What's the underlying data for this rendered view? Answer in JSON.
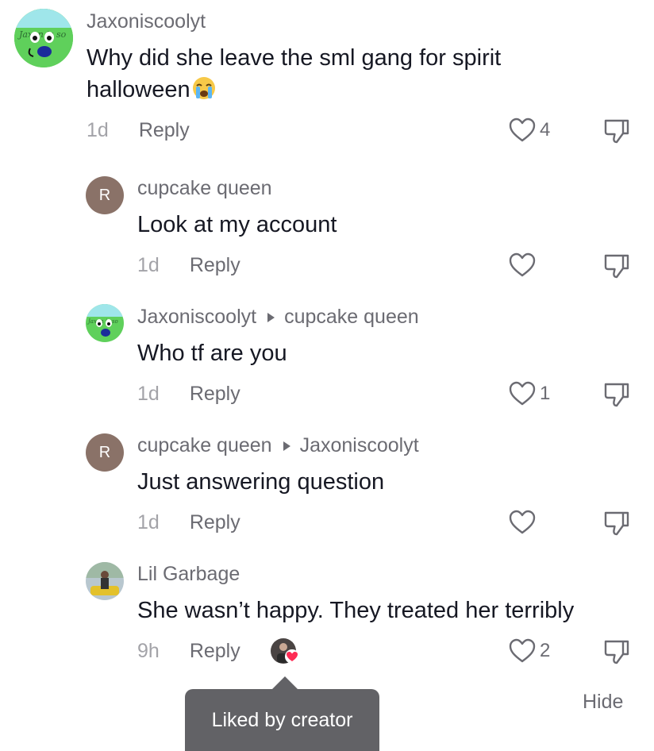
{
  "comments": [
    {
      "user": "Jaxoniscoolyt",
      "text": "Why did she leave the sml gang for spirit",
      "text2": "halloween",
      "time": "1d",
      "reply": "Reply",
      "likes": "4",
      "avatar_text": "Jaxon is so"
    },
    {
      "user": "cupcake queen",
      "avatar_letter": "R",
      "text": "Look at my account",
      "time": "1d",
      "reply": "Reply",
      "likes": ""
    },
    {
      "user": "Jaxoniscoolyt",
      "reply_to": "cupcake queen",
      "text": "Who tf are you",
      "time": "1d",
      "reply": "Reply",
      "likes": "1",
      "avatar_text": "Jaxon is so"
    },
    {
      "user": "cupcake queen",
      "avatar_letter": "R",
      "reply_to": "Jaxoniscoolyt",
      "text": "Just answering question",
      "time": "1d",
      "reply": "Reply",
      "likes": ""
    },
    {
      "user": "Lil Garbage",
      "text": "She wasn’t happy. They treated her terribly",
      "time": "9h",
      "reply": "Reply",
      "likes": "2"
    }
  ],
  "tooltip": {
    "text": "Liked by creator"
  },
  "hide_label": "Hide",
  "colors": {
    "heart_red": "#fe2c55",
    "avatar_brown": "#8a7268"
  }
}
